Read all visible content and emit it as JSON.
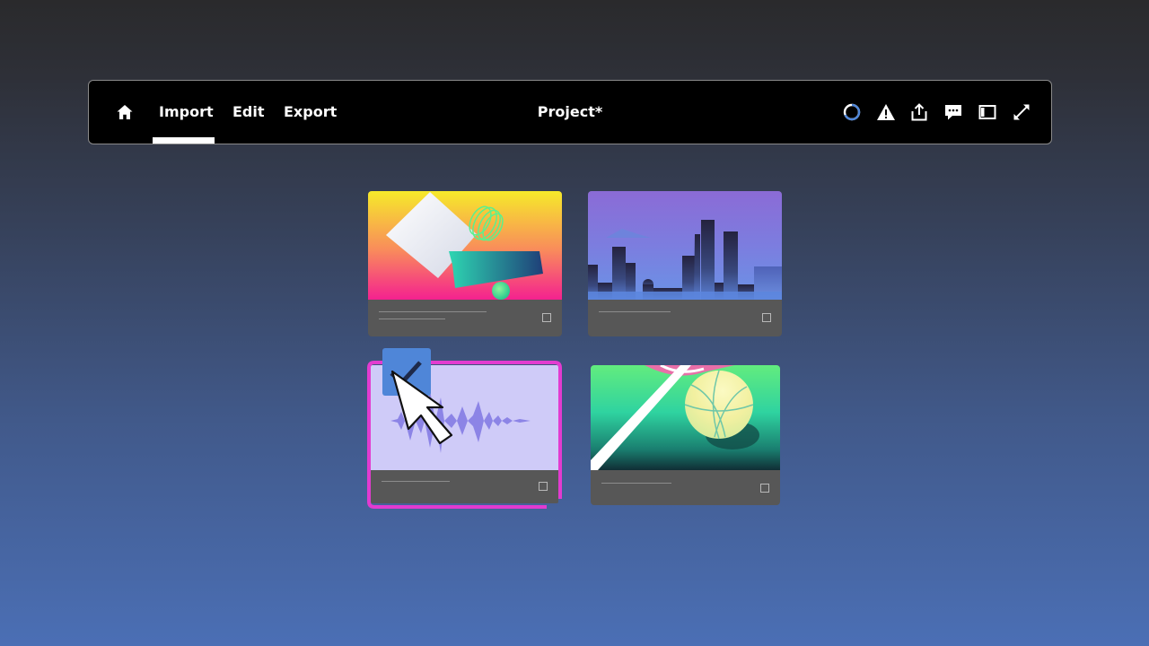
{
  "toolbar": {
    "home_icon": "home-icon",
    "tabs": [
      {
        "label": "Import",
        "active": true
      },
      {
        "label": "Edit",
        "active": false
      },
      {
        "label": "Export",
        "active": false
      }
    ],
    "project_title": "Project*",
    "icons": [
      "sync-status-icon",
      "alert-icon",
      "share-icon",
      "comments-icon",
      "panel-toggle-icon",
      "fullscreen-icon"
    ]
  },
  "cards": [
    {
      "thumbnail": "abstract-shapes",
      "selected": false
    },
    {
      "thumbnail": "city-skyline",
      "selected": false
    },
    {
      "thumbnail": "audio-waveform",
      "selected": true
    },
    {
      "thumbnail": "basketball-court",
      "selected": false
    }
  ],
  "colors": {
    "selection": "#e23bd0",
    "check_badge": "#4f86d8",
    "sync_accent": "#4f86d8",
    "card_meta": "#575757"
  }
}
